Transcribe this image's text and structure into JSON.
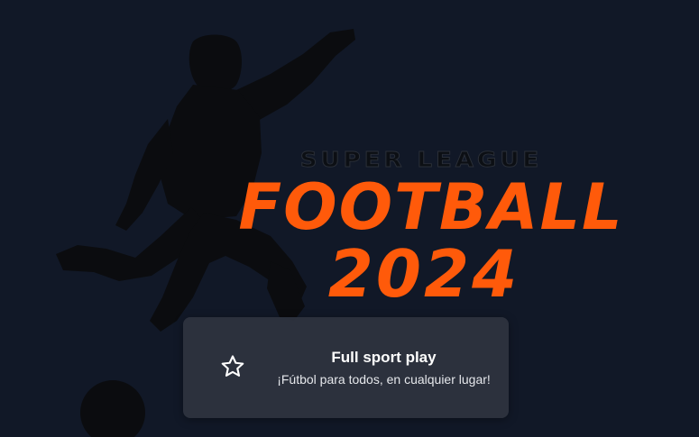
{
  "hero": {
    "brand_line": "SUPER LEAGUE",
    "title": "FOOTBALL",
    "year": "2024"
  },
  "card": {
    "icon": "star-outline-icon",
    "title": "Full sport play",
    "subtitle": "¡Fútbol para todos, en cualquier lugar!"
  },
  "colors": {
    "background": "#111827",
    "accent": "#ff5a0a",
    "card_bg": "#2e3440",
    "silhouette": "#0b0c0f"
  }
}
